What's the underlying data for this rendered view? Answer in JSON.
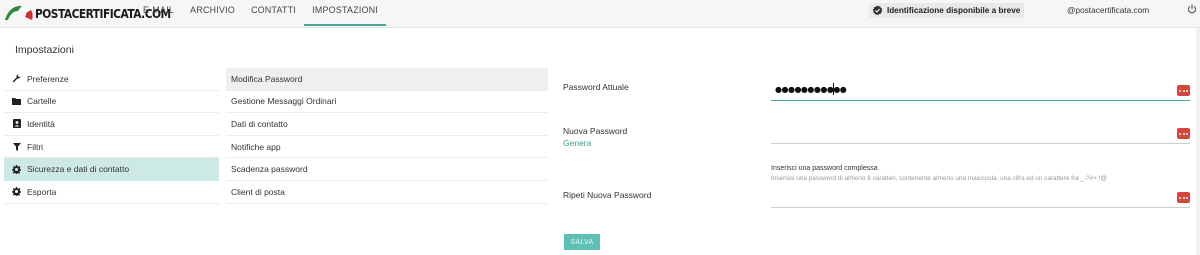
{
  "brand": {
    "name": "POSTACERTIFICATA.COM",
    "flag_colors": [
      "#2e8b3e",
      "#ffffff",
      "#d32f2f"
    ]
  },
  "nav": {
    "items": [
      "E-MAIL",
      "ARCHIVIO",
      "CONTATTI",
      "IMPOSTAZIONI"
    ],
    "active": "IMPOSTAZIONI",
    "accent": "#4aa59a"
  },
  "header": {
    "badge": "Identificazione disponibile a breve",
    "email": "@postacertificata.com",
    "icons": [
      "verified-badge-icon",
      "power-icon"
    ]
  },
  "page": {
    "title": "Impostazioni"
  },
  "sidebar": {
    "items": [
      {
        "label": "Preferenze",
        "icon": "wrench-icon"
      },
      {
        "label": "Cartelle",
        "icon": "folder-icon"
      },
      {
        "label": "Identità",
        "icon": "id-card-icon"
      },
      {
        "label": "Filtri",
        "icon": "filter-icon"
      },
      {
        "label": "Sicurezza e dati di contatto",
        "icon": "gear-icon"
      },
      {
        "label": "Esporta",
        "icon": "gear-icon"
      }
    ],
    "active": "Sicurezza e dati di contatto",
    "active_bg": "#cde9e6"
  },
  "submenu": {
    "items": [
      "Modifica Password",
      "Gestione Messaggi Ordinari",
      "Dati di contatto",
      "Notifiche app",
      "Scadenza password",
      "Client di posta"
    ],
    "active": "Modifica Password"
  },
  "form": {
    "current_password": {
      "label": "Password Attuale",
      "value": "●●●●●●●●●●●"
    },
    "new_password": {
      "label": "Nuova Password",
      "value": "",
      "generate_link": "Genera"
    },
    "hint": {
      "title": "Inserisci una password complessa",
      "text": "Inserisci una password di almeno 8 caratteri, contenente almeno una maiuscola, una cifra ed un carattere fra _-?#+;!@"
    },
    "repeat_password": {
      "label": "Ripeti Nuova Password",
      "value": ""
    },
    "save_label": "SALVA",
    "key_icon_color": "#d9443b"
  }
}
